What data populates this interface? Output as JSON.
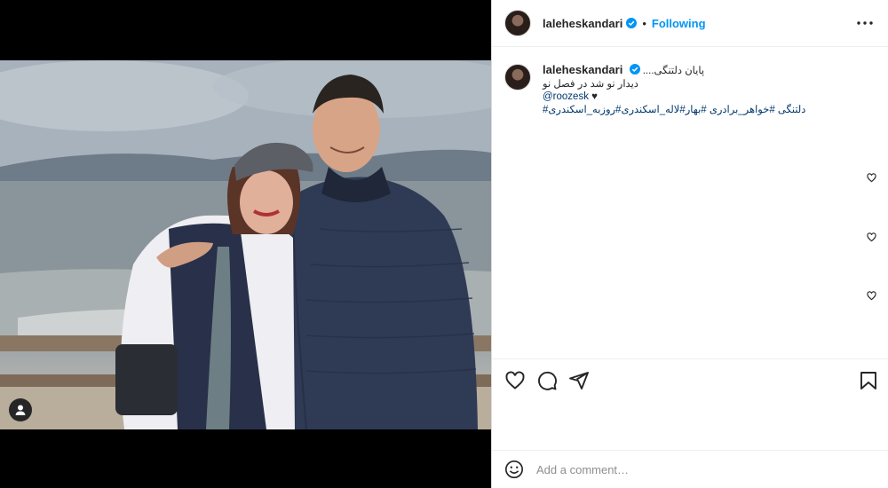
{
  "post": {
    "username": "laleheskandari",
    "follow_status": "Following",
    "caption": {
      "line1": "پایان دلتنگی....",
      "line2": "دیدار نو شد در فصل نو",
      "mention": "@roozesk",
      "heart": "♥",
      "hashtags": "دلتنگی #خواهر_برادری #بهار#لاله_اسکندری#روزبه_اسکندری#"
    }
  },
  "icons": {
    "more": "more-options-icon",
    "verified": "verified-badge-icon",
    "like": "heart-icon",
    "comment": "comment-bubble-icon",
    "share": "paper-plane-icon",
    "save": "bookmark-icon",
    "emoji": "smiley-icon",
    "tag": "user-tag-icon"
  },
  "comment_box": {
    "placeholder": "Add a comment…"
  },
  "colors": {
    "accent": "#0095f6",
    "link": "#00376b",
    "text": "#262626"
  }
}
